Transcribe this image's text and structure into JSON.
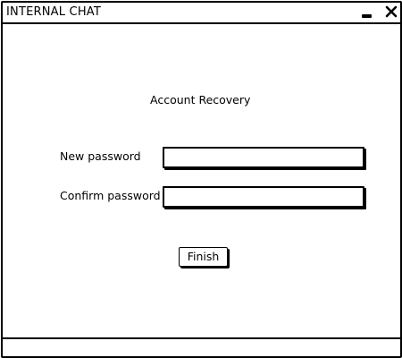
{
  "window": {
    "title": "INTERNAL CHAT"
  },
  "titlebar_icons": {
    "minimize": "minimize-icon",
    "close": "close-icon"
  },
  "form": {
    "heading": "Account Recovery",
    "new_password_label": "New password",
    "new_password_value": "",
    "confirm_password_label": "Confirm password",
    "confirm_password_value": "",
    "finish_label": "Finish"
  },
  "statusbar": {
    "text": ""
  }
}
